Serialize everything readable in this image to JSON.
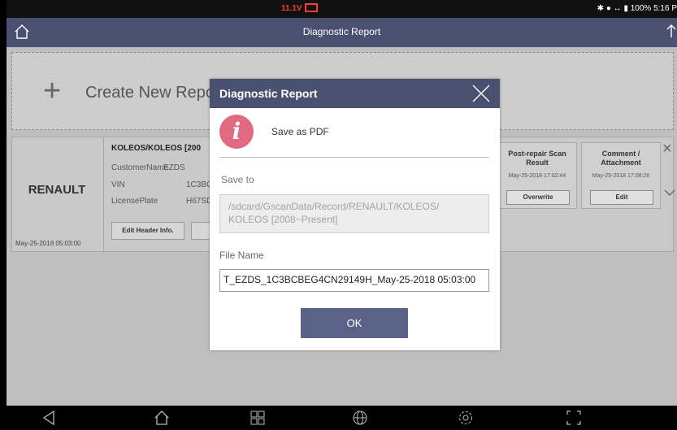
{
  "status_bar": {
    "voltage": "11.1V",
    "right_text": "100% 5:16 P"
  },
  "title_bar": {
    "title": "Diagnostic Report"
  },
  "create": {
    "label": "Create New Repo"
  },
  "record": {
    "brand": "RENAULT",
    "date": "May-25-2018 05:03:00",
    "model": "KOLEOS/KOLEOS [200",
    "fields": [
      {
        "label": "CustomerName",
        "value": "EZDS"
      },
      {
        "label": "VIN",
        "value": "1C3BC"
      },
      {
        "label": "LicensePlate",
        "value": "H67SD"
      }
    ],
    "edit_header_label": "Edit Header Info.",
    "cards": [
      {
        "title": "Post-repair Scan Result",
        "date": "May-25-2018 17:02:44",
        "button": "Overwrite"
      },
      {
        "title": "Comment / Attachment",
        "date": "May-25-2018 17:08:26",
        "button": "Edit"
      }
    ]
  },
  "dialog": {
    "title": "Diagnostic Report",
    "message": "Save as PDF",
    "save_to_label": "Save to",
    "save_to_path": "/sdcard/GscanData/Record/RENAULT/KOLEOS/ KOLEOS [2008~Present]",
    "file_name_label": "File Name",
    "file_name_value": "T_EZDS_1C3BCBEG4CN29149H_May-25-2018 05:03:00",
    "ok_label": "OK"
  },
  "icons": {
    "home": "home-icon",
    "upload": "upload-icon",
    "close": "close-icon",
    "info": "info-icon",
    "back": "back-icon",
    "apps": "apps-icon",
    "globe": "globe-icon",
    "settings": "settings-icon",
    "screenshot": "screenshot-icon"
  },
  "colors": {
    "header": "#4a5170",
    "ok_button": "#5a6287",
    "info_icon": "#e06a7f",
    "voltage": "#ff3b30"
  }
}
